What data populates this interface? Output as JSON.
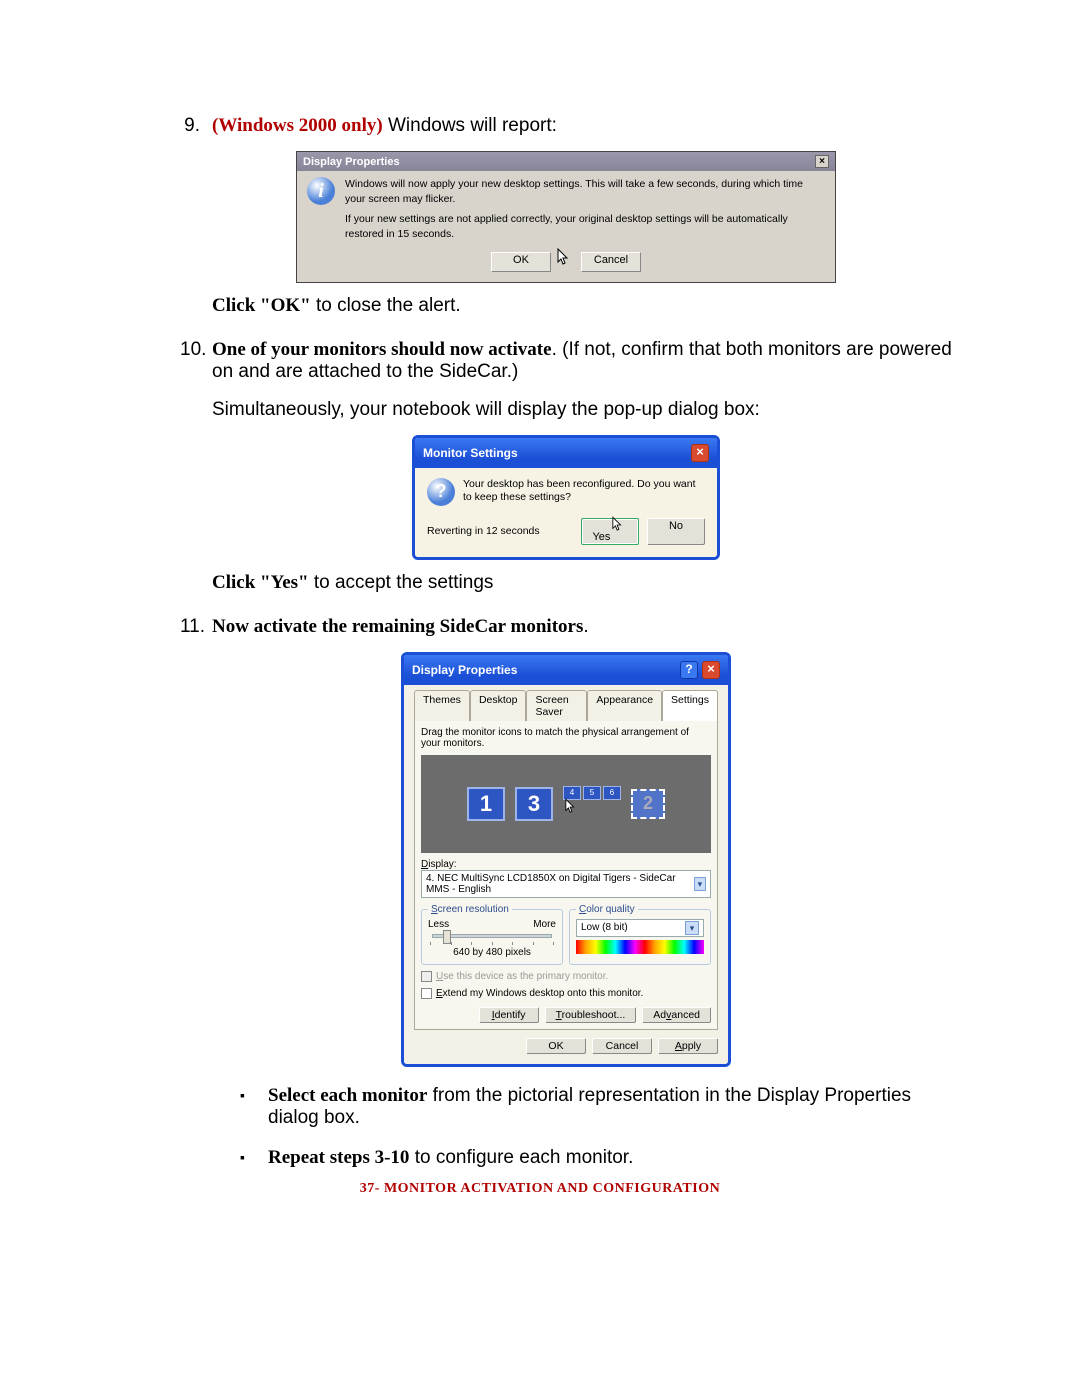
{
  "step9": {
    "num": "9.",
    "prefix": "(Windows 2000 only)",
    "text": " Windows will report:",
    "after_bold": "Click \"OK\"",
    "after_rest": " to close the alert."
  },
  "dlg1": {
    "title": "Display Properties",
    "msg1": "Windows will now apply your new desktop settings. This will take a few seconds, during which time your screen may flicker.",
    "msg2": "If your new settings are not applied correctly, your original desktop settings will be automatically restored in 15 seconds.",
    "ok": "OK",
    "cancel": "Cancel"
  },
  "step10": {
    "num": "10.",
    "bold": "One of your monitors should now activate",
    "rest": ". (If not, confirm that both monitors are powered on and are attached to the SideCar.)",
    "line2": "Simultaneously, your notebook will display the pop-up dialog box:",
    "after_bold": "Click \"Yes\"",
    "after_rest": " to accept the settings"
  },
  "dlg2": {
    "title": "Monitor Settings",
    "msg": "Your desktop has been reconfigured. Do you want to keep these settings?",
    "revert": "Reverting in 12 seconds",
    "yes": "Yes",
    "no": "No"
  },
  "step11": {
    "num": "11.",
    "bold": "Now activate the remaining SideCar monitors",
    "rest": "."
  },
  "dlg3": {
    "title": "Display Properties",
    "tabs": [
      "Themes",
      "Desktop",
      "Screen Saver",
      "Appearance",
      "Settings"
    ],
    "instr": "Drag the monitor icons to match the physical arrangement of your monitors.",
    "mon1": "1",
    "mon3": "3",
    "mon2": "2",
    "display_label": "Display:",
    "display_value": "4. NEC MultiSync LCD1850X on Digital Tigers - SideCar MMS - English",
    "res_legend": "Screen resolution",
    "less": "Less",
    "more": "More",
    "res_caption": "640 by 480 pixels",
    "cq_legend": "Color quality",
    "cq_value": "Low (8 bit)",
    "chk_primary": "Use this device as the primary monitor.",
    "chk_extend": "Extend my Windows desktop onto this monitor.",
    "identify": "Identify",
    "troubleshoot": "Troubleshoot...",
    "advanced": "Advanced",
    "ok": "OK",
    "cancel": "Cancel",
    "apply": "Apply"
  },
  "bullets": {
    "b1_bold": "Select each monitor",
    "b1_rest": " from the pictorial representation in the Display Properties dialog box.",
    "b2_bold": "Repeat steps 3-10",
    "b2_rest": " to configure each monitor."
  },
  "footer": {
    "page": "37-",
    "title": " MONITOR ACTIVATION AND CONFIGURATION"
  }
}
